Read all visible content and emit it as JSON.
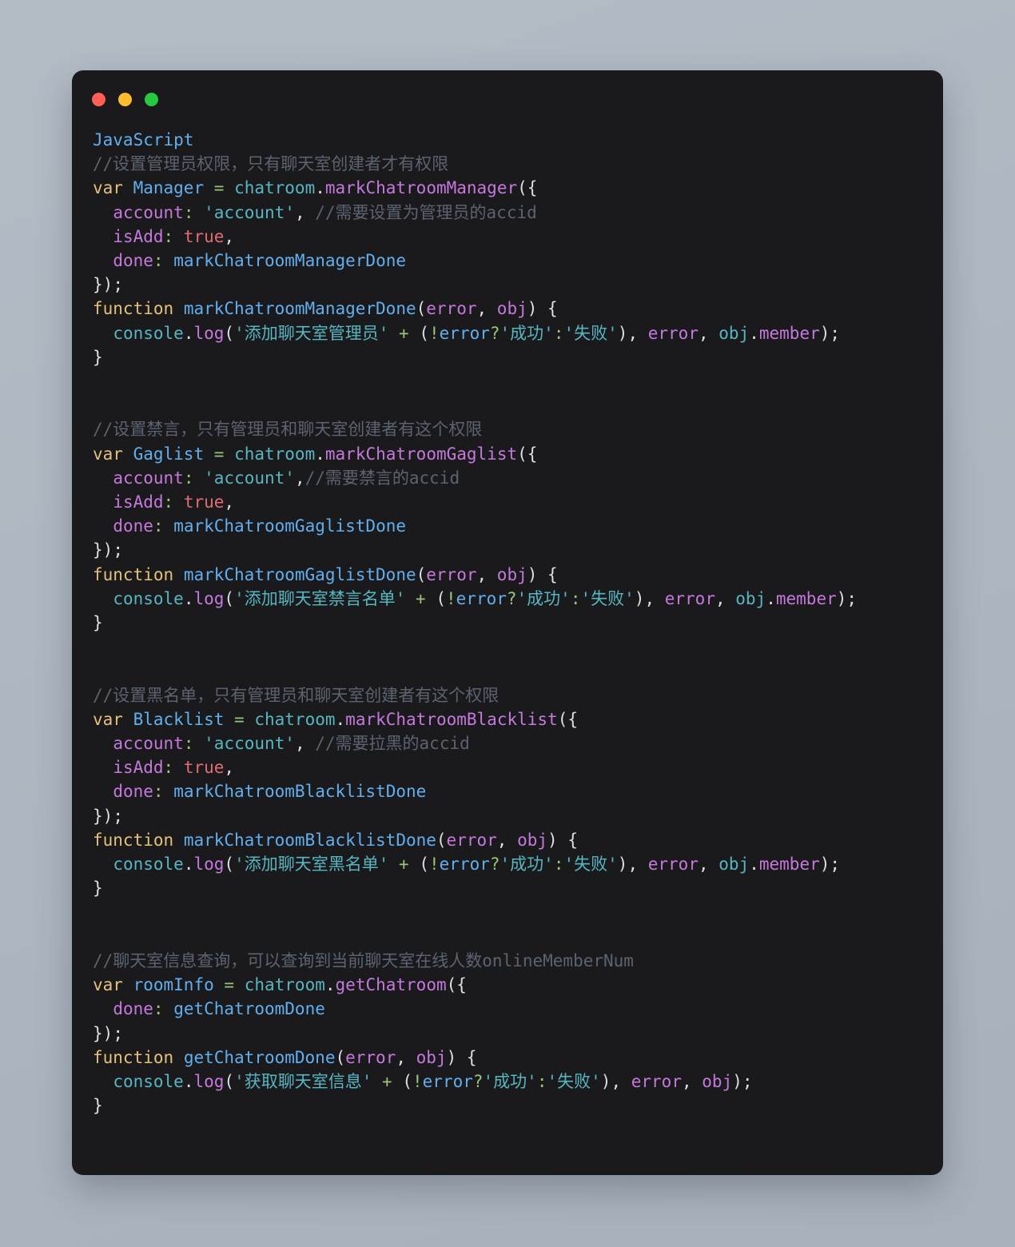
{
  "window": {
    "traffic_lights": [
      {
        "name": "close",
        "color": "#ff5f56"
      },
      {
        "name": "minimize",
        "color": "#ffbd2e"
      },
      {
        "name": "zoom",
        "color": "#27c93f"
      }
    ],
    "background": "#1a1a1c",
    "page_background": "#aeb7c1"
  },
  "editor": {
    "language_label": "JavaScript",
    "theme_colors": {
      "comment": "#5c6370",
      "keyword": "#e5c07b",
      "variable": "#61afef",
      "object": "#56b6c2",
      "method": "#c678dd",
      "string": "#56b6c2",
      "boolean": "#e06c75",
      "operator": "#98c379",
      "punctuation": "#dcdfe4"
    },
    "blocks": [
      {
        "id": "manager",
        "lines": [
          {
            "type": "comment",
            "text": "//设置管理员权限，只有聊天室创建者才有权限"
          },
          {
            "type": "code",
            "text": "var Manager = chatroom.markChatroomManager({"
          },
          {
            "type": "code",
            "text": "  account: 'account', //需要设置为管理员的accid"
          },
          {
            "type": "code",
            "text": "  isAdd: true,"
          },
          {
            "type": "code",
            "text": "  done: markChatroomManagerDone"
          },
          {
            "type": "code",
            "text": "});"
          },
          {
            "type": "code",
            "text": "function markChatroomManagerDone(error, obj) {"
          },
          {
            "type": "code",
            "text": "  console.log('添加聊天室管理员' + (!error?'成功':'失败'), error, obj.member);"
          },
          {
            "type": "code",
            "text": "}"
          }
        ]
      },
      {
        "id": "gaglist",
        "lines": [
          {
            "type": "comment",
            "text": "//设置禁言，只有管理员和聊天室创建者有这个权限"
          },
          {
            "type": "code",
            "text": "var Gaglist = chatroom.markChatroomGaglist({"
          },
          {
            "type": "code",
            "text": "  account: 'account',//需要禁言的accid"
          },
          {
            "type": "code",
            "text": "  isAdd: true,"
          },
          {
            "type": "code",
            "text": "  done: markChatroomGaglistDone"
          },
          {
            "type": "code",
            "text": "});"
          },
          {
            "type": "code",
            "text": "function markChatroomGaglistDone(error, obj) {"
          },
          {
            "type": "code",
            "text": "  console.log('添加聊天室禁言名单' + (!error?'成功':'失败'), error, obj.member);"
          },
          {
            "type": "code",
            "text": "}"
          }
        ]
      },
      {
        "id": "blacklist",
        "lines": [
          {
            "type": "comment",
            "text": "//设置黑名单，只有管理员和聊天室创建者有这个权限"
          },
          {
            "type": "code",
            "text": "var Blacklist = chatroom.markChatroomBlacklist({"
          },
          {
            "type": "code",
            "text": "  account: 'account', //需要拉黑的accid"
          },
          {
            "type": "code",
            "text": "  isAdd: true,"
          },
          {
            "type": "code",
            "text": "  done: markChatroomBlacklistDone"
          },
          {
            "type": "code",
            "text": "});"
          },
          {
            "type": "code",
            "text": "function markChatroomBlacklistDone(error, obj) {"
          },
          {
            "type": "code",
            "text": "  console.log('添加聊天室黑名单' + (!error?'成功':'失败'), error, obj.member);"
          },
          {
            "type": "code",
            "text": "}"
          }
        ]
      },
      {
        "id": "roominfo",
        "lines": [
          {
            "type": "comment",
            "text": "//聊天室信息查询，可以查询到当前聊天室在线人数onlineMemberNum"
          },
          {
            "type": "code",
            "text": "var roomInfo = chatroom.getChatroom({"
          },
          {
            "type": "code",
            "text": "  done: getChatroomDone"
          },
          {
            "type": "code",
            "text": "});"
          },
          {
            "type": "code",
            "text": "function getChatroomDone(error, obj) {"
          },
          {
            "type": "code",
            "text": "  console.log('获取聊天室信息' + (!error?'成功':'失败'), error, obj);"
          },
          {
            "type": "code",
            "text": "}"
          }
        ]
      }
    ]
  }
}
